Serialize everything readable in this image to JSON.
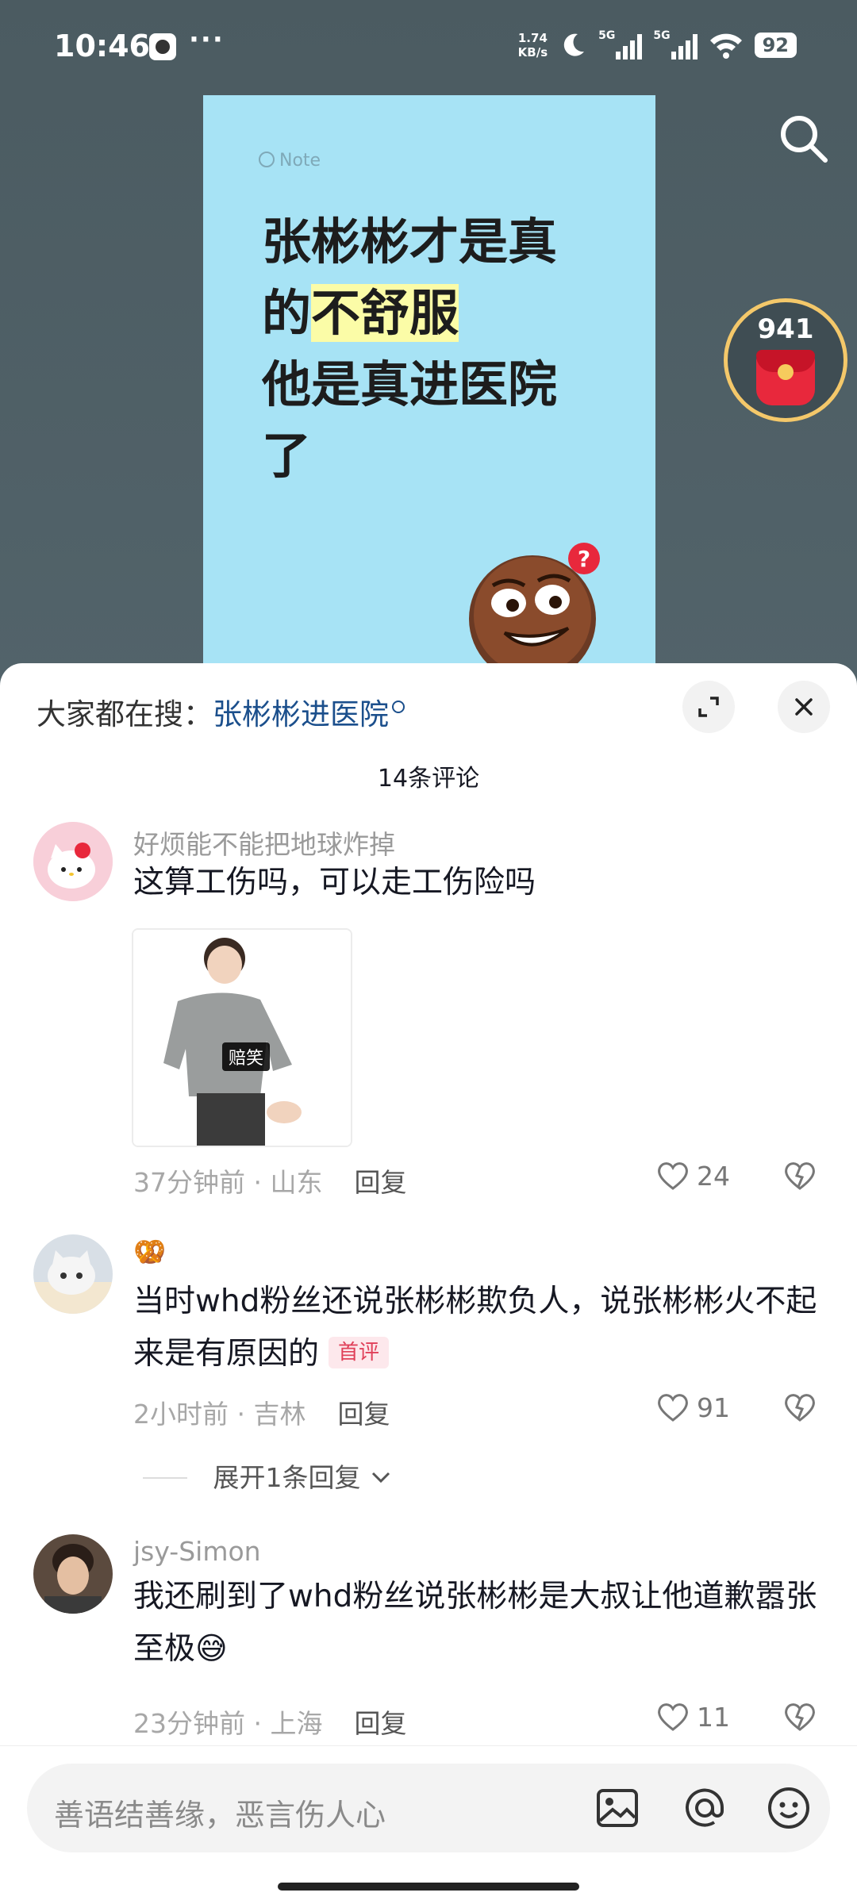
{
  "status_bar": {
    "time": "10:46",
    "dots": "···",
    "net_speed_value": "1.74",
    "net_speed_unit": "KB/s",
    "signal_1": "5G",
    "signal_2": "5G",
    "battery": "92"
  },
  "video": {
    "note_tag": "Note",
    "note_line_1": "张彬彬才是真",
    "note_line_2_pre": "的",
    "note_line_2_highlight": "不舒服",
    "note_line_3": "他是真进医院",
    "note_line_4": "了",
    "red_packet_count": "941"
  },
  "sheet": {
    "hot_search_label": "大家都在搜：",
    "hot_search_keyword": "张彬彬进医院",
    "comment_count": "14条评论"
  },
  "comments": [
    {
      "username": "好烦能不能把地球炸掉",
      "text": "这算工伤吗，可以走工伤险吗",
      "sticker_label": "赔笑",
      "time": "37分钟前",
      "location": "山东",
      "reply": "回复",
      "likes": "24"
    },
    {
      "username": "🥨",
      "text": "当时whd粉丝还说张彬彬欺负人，说张彬彬火不起来是有原因的",
      "badge": "首评",
      "time": "2小时前",
      "location": "吉林",
      "reply": "回复",
      "likes": "91",
      "expand": "展开1条回复"
    },
    {
      "username": "jsy-Simon",
      "text": "我还刷到了whd粉丝说张彬彬是大叔让他道歉嚣张至极",
      "emoji": "😅",
      "time": "23分钟前",
      "location": "上海",
      "reply": "回复",
      "likes": "11"
    }
  ],
  "input": {
    "placeholder": "善语结善缘，恶言伤人心"
  },
  "icons": [
    "search-icon",
    "red-packet-icon",
    "expand-icon",
    "close-icon",
    "heart-icon",
    "dislike-icon",
    "image-icon",
    "at-icon",
    "emoji-icon",
    "chevron-down-icon"
  ],
  "colors": {
    "accent_link": "#1b4f8c",
    "badge_bg": "#fde8ec",
    "badge_text": "#e0415a",
    "note_bg": "#a7e3f5",
    "highlight": "#fbfca7"
  }
}
